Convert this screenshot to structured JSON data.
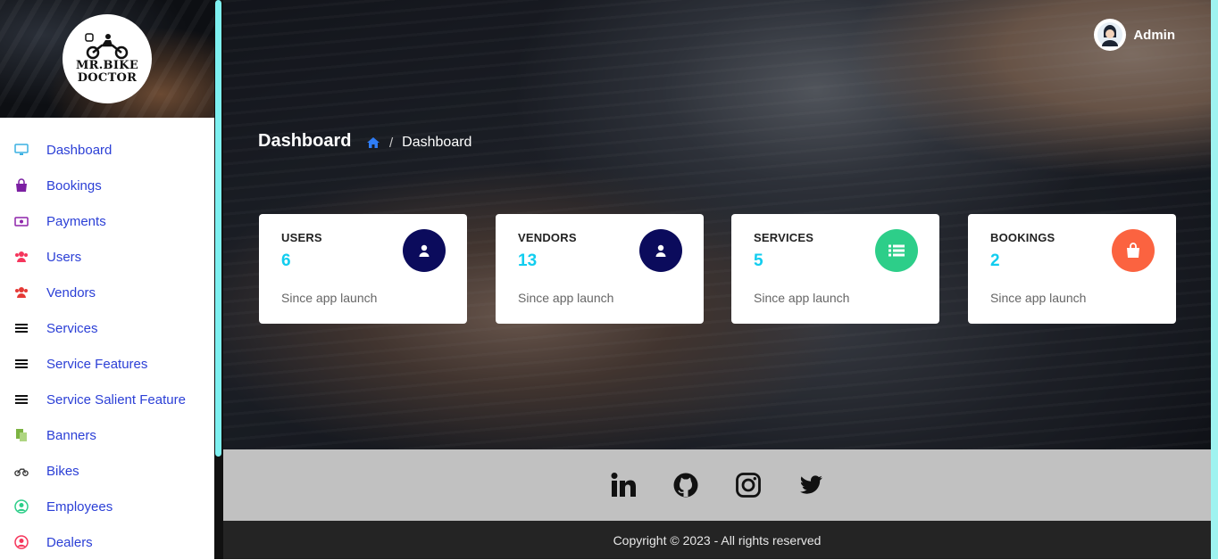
{
  "brand": {
    "logo_line1": "MR.BIKE",
    "logo_line2": "DOCTOR"
  },
  "sidebar": {
    "items": [
      {
        "label": "Dashboard",
        "icon": "monitor-icon",
        "color": "#3ab0e2"
      },
      {
        "label": "Bookings",
        "icon": "shopping-bag-icon",
        "color": "#7b1fa2"
      },
      {
        "label": "Payments",
        "icon": "money-icon",
        "color": "#8e24aa"
      },
      {
        "label": "Users",
        "icon": "users-icon",
        "color": "#f5365c"
      },
      {
        "label": "Vendors",
        "icon": "users-icon",
        "color": "#e53935"
      },
      {
        "label": "Services",
        "icon": "list-icon",
        "color": "#111111"
      },
      {
        "label": "Service Features",
        "icon": "list-icon",
        "color": "#111111"
      },
      {
        "label": "Service Salient Feature",
        "icon": "list-icon",
        "color": "#111111"
      },
      {
        "label": "Banners",
        "icon": "copy-icon",
        "color": "#7cb342"
      },
      {
        "label": "Bikes",
        "icon": "motorcycle-icon",
        "color": "#333333"
      },
      {
        "label": "Employees",
        "icon": "user-circle-icon",
        "color": "#2dce89"
      },
      {
        "label": "Dealers",
        "icon": "user-circle-icon",
        "color": "#f5365c"
      }
    ]
  },
  "header": {
    "user_name": "Admin"
  },
  "page": {
    "title": "Dashboard",
    "breadcrumb_current": "Dashboard"
  },
  "stats": [
    {
      "title": "USERS",
      "value": "6",
      "sub": "Since app launch",
      "icon": "user-icon",
      "color": "#0b0b5c"
    },
    {
      "title": "VENDORS",
      "value": "13",
      "sub": "Since app launch",
      "icon": "user-icon",
      "color": "#0b0b5c"
    },
    {
      "title": "SERVICES",
      "value": "5",
      "sub": "Since app launch",
      "icon": "list-icon",
      "color": "#2dce89"
    },
    {
      "title": "BOOKINGS",
      "value": "2",
      "sub": "Since app launch",
      "icon": "shopping-bag-icon",
      "color": "#fb6340"
    }
  ],
  "social": [
    "linkedin-icon",
    "github-icon",
    "instagram-icon",
    "twitter-icon"
  ],
  "footer": {
    "copyright": "Copyright © 2023 - All rights reserved"
  }
}
